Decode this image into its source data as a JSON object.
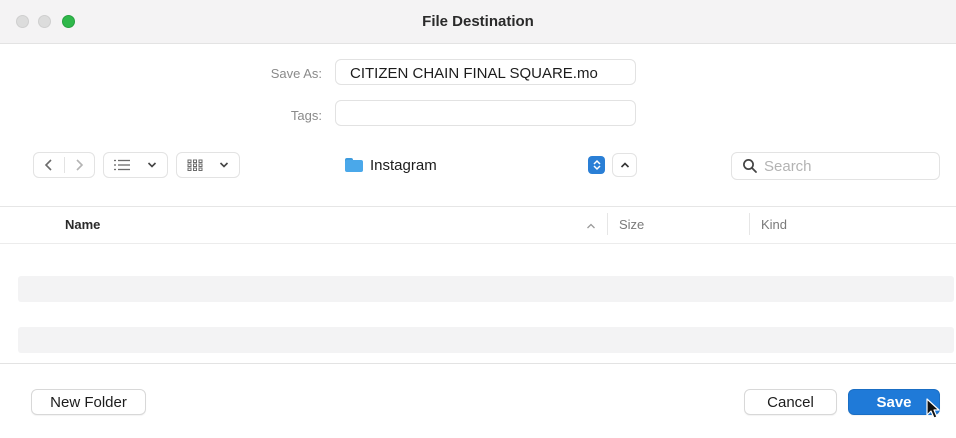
{
  "window": {
    "title": "File Destination"
  },
  "form": {
    "save_as_label": "Save As:",
    "save_as_value": "CITIZEN CHAIN FINAL SQUARE.mo",
    "tags_label": "Tags:",
    "tags_value": ""
  },
  "toolbar": {
    "back_icon": "chevron-left-icon",
    "forward_icon": "chevron-right-icon",
    "list_view_icon": "list-icon",
    "grid_view_icon": "grid-icon",
    "location_label": "Instagram",
    "search_placeholder": "Search"
  },
  "list": {
    "columns": [
      "Name",
      "Size",
      "Kind"
    ]
  },
  "footer": {
    "new_folder_label": "New Folder",
    "cancel_label": "Cancel",
    "save_label": "Save"
  },
  "colors": {
    "accent": "#1f7ad8",
    "maximize": "#2fb84a",
    "folder": "#4aa8ea"
  }
}
